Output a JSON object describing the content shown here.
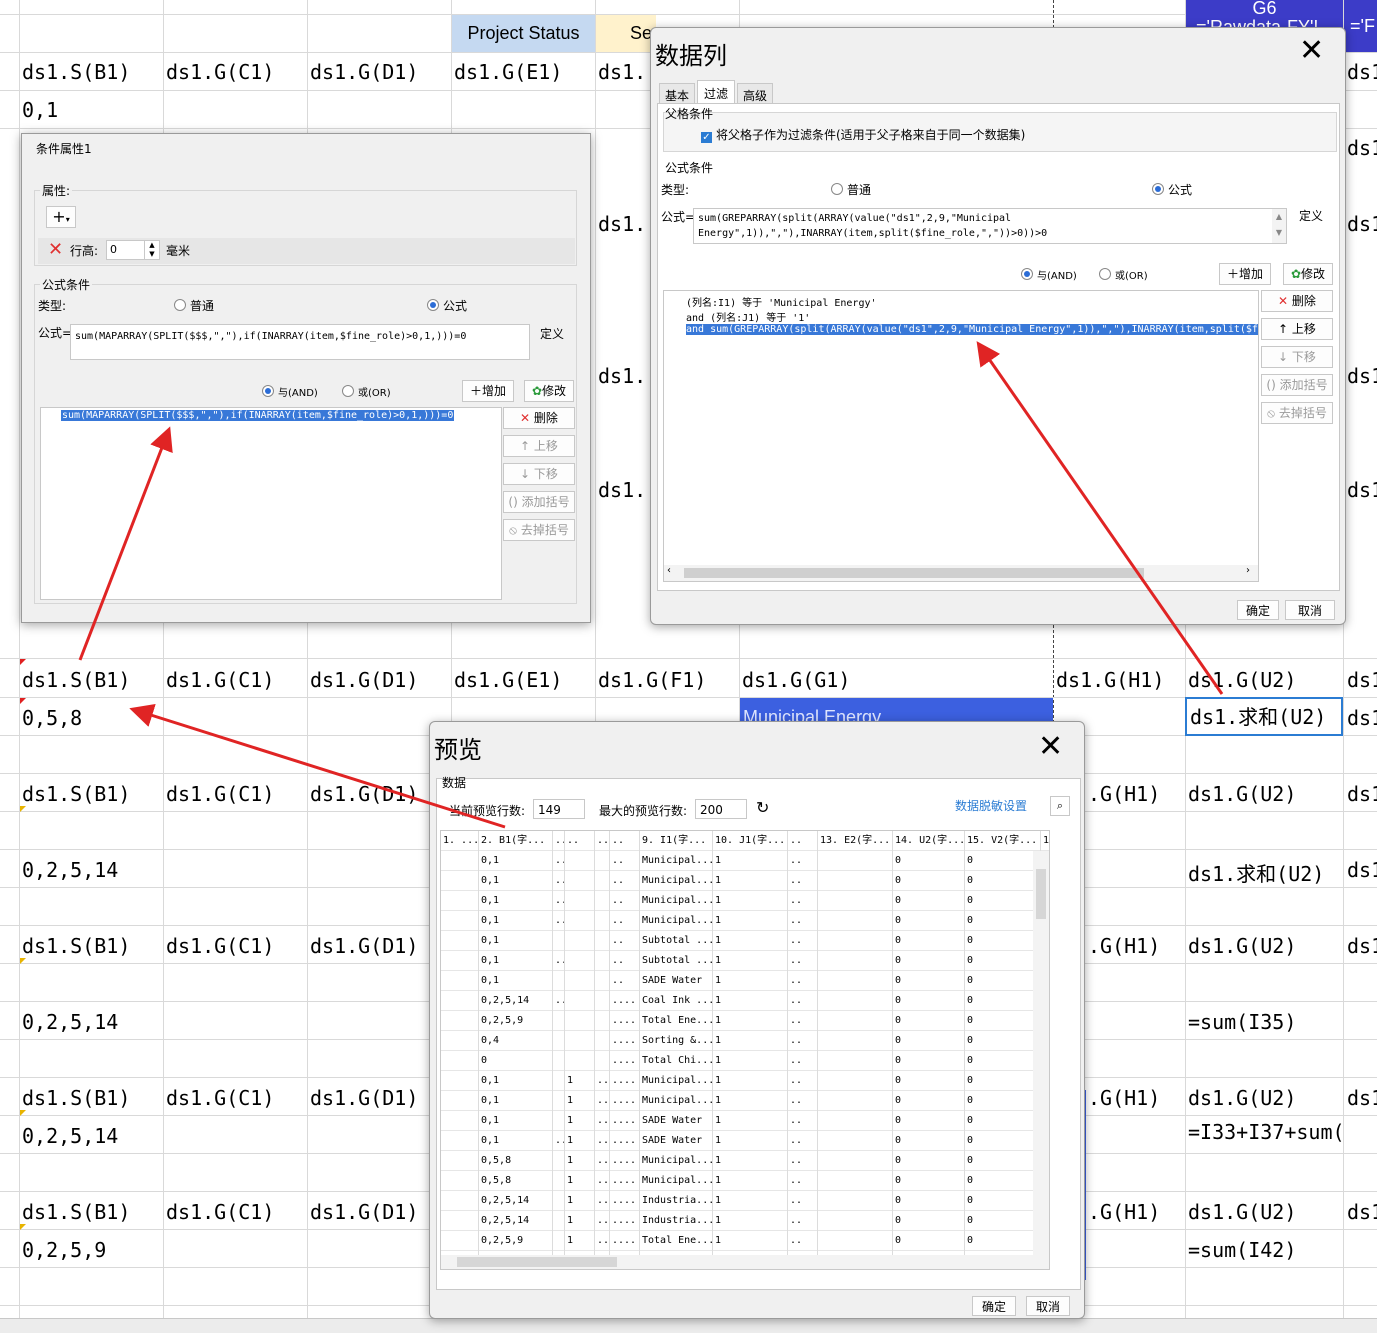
{
  "sheet": {
    "header_row": {
      "project_status": "Project Status",
      "se_partial": "Se",
      "g6_partial": "G6",
      "rawdata_partial": "='Rawdata-FY'!",
      "f_partial": "='F"
    },
    "rows": {
      "r1": [
        "ds1.S(B1)",
        "ds1.G(C1)",
        "ds1.G(D1)",
        "ds1.G(E1)",
        "ds1.("
      ],
      "r1_right": "ds1",
      "r2": "0,1",
      "r_mid_right": [
        "ds1",
        "ds1",
        "ds1",
        "ds1"
      ],
      "r_mid_left": [
        "ds1.(",
        "ds1.(",
        "ds1.("
      ],
      "r3": [
        "ds1.S(B1)",
        "ds1.G(C1)",
        "ds1.G(D1)",
        "ds1.G(E1)",
        "ds1.G(F1)",
        "ds1.G(G1)",
        "ds1.G(H1)",
        "ds1.G(U2)",
        "ds1"
      ],
      "r4": {
        "b": "0,5,8",
        "municipal": "Municipal Energy",
        "u": "ds1.求和(U2)",
        "v": "ds1"
      },
      "r5": [
        "ds1.S(B1)",
        "ds1.G(C1)",
        "ds1.G(D1)",
        ".G(H1)",
        "ds1.G(U2)",
        "ds1"
      ],
      "r6": {
        "b": "0,2,5,14",
        "u": "ds1.求和(U2)",
        "v": "ds1"
      },
      "r7": [
        "ds1.S(B1)",
        "ds1.G(C1)",
        "ds1.G(D1)",
        ".G(H1)",
        "ds1.G(U2)",
        "ds1"
      ],
      "r8": {
        "b": "0,2,5,14",
        "u": "=sum(I35)"
      },
      "r9": [
        "ds1.S(B1)",
        "ds1.G(C1)",
        "ds1.G(D1)",
        ".G(H1)",
        "ds1.G(U2)",
        "ds1"
      ],
      "r10": {
        "b": "0,2,5,14",
        "u": "=I33+I37+sum("
      },
      "r11": [
        "ds1.S(B1)",
        "ds1.G(C1)",
        "ds1.G(D1)",
        ".G(H1)",
        "ds1.G(U2)",
        "ds1"
      ],
      "r12": {
        "b": "0,2,5,9",
        "u": "=sum(I42)"
      }
    }
  },
  "cond_dialog": {
    "title": "条件属性1",
    "attr_group": "属性:",
    "add_icon_label": "+",
    "row_height_label": "行高:",
    "row_height_value": "0",
    "row_height_unit": "毫米",
    "formula_group": "公式条件",
    "type_label": "类型:",
    "type_normal": "普通",
    "type_formula": "公式",
    "formula_label": "公式=",
    "formula_value": "sum(MAPARRAY(SPLIT($$$,\",\"),if(INARRAY(item,$fine_role)>0,1,)))=0",
    "define_btn": "定义",
    "and_label": "与(AND)",
    "or_label": "或(OR)",
    "add_btn": "增加",
    "modify_btn": "修改",
    "list_item": "sum(MAPARRAY(SPLIT($$$,\",\"),if(INARRAY(item,$fine_role)>0,1,)))=0",
    "delete_btn": "删除",
    "up_btn": "上移",
    "down_btn": "下移",
    "add_paren_btn": "添加括号",
    "remove_paren_btn": "去掉括号"
  },
  "data_col_dialog": {
    "title": "数据列",
    "tabs": [
      "基本",
      "过滤",
      "高级"
    ],
    "parent_group": "父格条件",
    "parent_check": "将父格子作为过滤条件(适用于父子格来自于同一个数据集)",
    "formula_group": "公式条件",
    "type_label": "类型:",
    "type_normal": "普通",
    "type_formula": "公式",
    "formula_label": "公式=",
    "formula_line1": "sum(GREPARRAY(split(ARRAY(value(\"ds1\",2,9,\"Municipal",
    "formula_line2": "Energy\",1)),\",\"),INARRAY(item,split($fine_role,\",\"))>0))>0",
    "define_btn": "定义",
    "and_label": "与(AND)",
    "or_label": "或(OR)",
    "add_btn": "增加",
    "modify_btn": "修改",
    "list_items": [
      "(列名:I1) 等于 'Municipal Energy'",
      "and (列名:J1) 等于 '1'",
      "and sum(GREPARRAY(split(ARRAY(value(\"ds1\",2,9,\"Municipal Energy\",1)),\",\"),INARRAY(item,split($fi"
    ],
    "delete_btn": "删除",
    "up_btn": "上移",
    "down_btn": "下移",
    "add_paren_btn": "添加括号",
    "remove_paren_btn": "去掉括号",
    "ok_btn": "确定",
    "cancel_btn": "取消"
  },
  "preview_dialog": {
    "title": "预览",
    "data_group": "数据",
    "current_rows_label": "当前预览行数:",
    "current_rows_value": "149",
    "max_rows_label": "最大的预览行数:",
    "max_rows_value": "200",
    "desensitize_link": "数据脱敏设置",
    "headers": [
      "1. ...",
      "2. B1(字...",
      "..",
      "..",
      "..",
      "..",
      "9. I1(字...",
      "10. J1(字...",
      "..",
      "13. E2(字...",
      "14. U2(字...",
      "15. V2(字...",
      "1("
    ],
    "rows": [
      [
        "0,1",
        "..",
        "",
        "",
        "..",
        "Municipal...",
        "1",
        "..",
        "",
        "0",
        "0",
        "0"
      ],
      [
        "0,1",
        "..",
        "",
        "",
        "..",
        "Municipal...",
        "1",
        "..",
        "",
        "0",
        "0",
        "0"
      ],
      [
        "0,1",
        "..",
        "",
        "",
        "..",
        "Municipal...",
        "1",
        "..",
        "",
        "0",
        "0",
        "0"
      ],
      [
        "0,1",
        "..",
        "",
        "",
        "..",
        "Municipal...",
        "1",
        "..",
        "",
        "0",
        "0",
        "0"
      ],
      [
        "0,1",
        "",
        "",
        "",
        "..",
        "Subtotal ...",
        "1",
        "..",
        "",
        "0",
        "0",
        "0"
      ],
      [
        "0,1",
        "..",
        "",
        "",
        "..",
        "Subtotal ...",
        "1",
        "..",
        "",
        "0",
        "0",
        "0"
      ],
      [
        "0,1",
        "",
        "",
        "",
        "..",
        "SADE Water",
        "1",
        "..",
        "",
        "0",
        "0",
        "0"
      ],
      [
        "0,2,5,14",
        "..",
        "",
        "",
        "....",
        "Coal Ink ...",
        "1",
        "..",
        "",
        "0",
        "0",
        "0"
      ],
      [
        "0,2,5,9",
        "",
        "",
        "",
        "....",
        "Total Ene...",
        "1",
        "..",
        "",
        "0",
        "0",
        "0"
      ],
      [
        "0,4",
        "",
        "",
        "",
        "....",
        "Sorting &...",
        "1",
        "..",
        "",
        "0",
        "0",
        "0"
      ],
      [
        "0",
        "",
        "",
        "",
        "....",
        "Total Chi...",
        "1",
        "..",
        "",
        "0",
        "0",
        "0"
      ],
      [
        "0,1",
        "",
        "1",
        "..",
        "....",
        "Municipal...",
        "1",
        "..",
        "",
        "0",
        "0",
        "0"
      ],
      [
        "0,1",
        "",
        "1",
        "..",
        "....",
        "Municipal...",
        "1",
        "..",
        "",
        "0",
        "0",
        "0"
      ],
      [
        "0,1",
        "",
        "1",
        "..",
        "....",
        "SADE Water",
        "1",
        "..",
        "",
        "0",
        "0",
        "0"
      ],
      [
        "0,1",
        "..",
        "1",
        "..",
        "....",
        "SADE Water",
        "1",
        "..",
        "",
        "0",
        "0",
        "0"
      ],
      [
        "0,5,8",
        "",
        "1",
        "..",
        "....",
        "Municipal...",
        "1",
        "..",
        "",
        "0",
        "0",
        "0"
      ],
      [
        "0,5,8",
        "",
        "1",
        "..",
        "....",
        "Municipal...",
        "1",
        "..",
        "",
        "0",
        "0",
        "0"
      ],
      [
        "0,2,5,14",
        "",
        "1",
        "..",
        "....",
        "Industria...",
        "1",
        "..",
        "",
        "0",
        "0",
        "0"
      ],
      [
        "0,2,5,14",
        "",
        "1",
        "..",
        "....",
        "Industria...",
        "1",
        "..",
        "",
        "0",
        "0",
        "0"
      ],
      [
        "0,2,5,9",
        "",
        "1",
        "..",
        "....",
        "Total Ene...",
        "1",
        "..",
        "",
        "0",
        "0",
        "0"
      ],
      [
        "0,2,5,9",
        "",
        "1",
        "..",
        "....",
        "Total Ene...",
        "1",
        "..",
        "",
        "0",
        "0",
        "0"
      ]
    ],
    "ok_btn": "确定",
    "cancel_btn": "取消"
  },
  "colors": {
    "accent": "#3878d8",
    "header_blue": "#c5d9f1",
    "header_yellow": "#fff2cc",
    "navy": "#3c3cc8",
    "arrow": "#e02424"
  }
}
